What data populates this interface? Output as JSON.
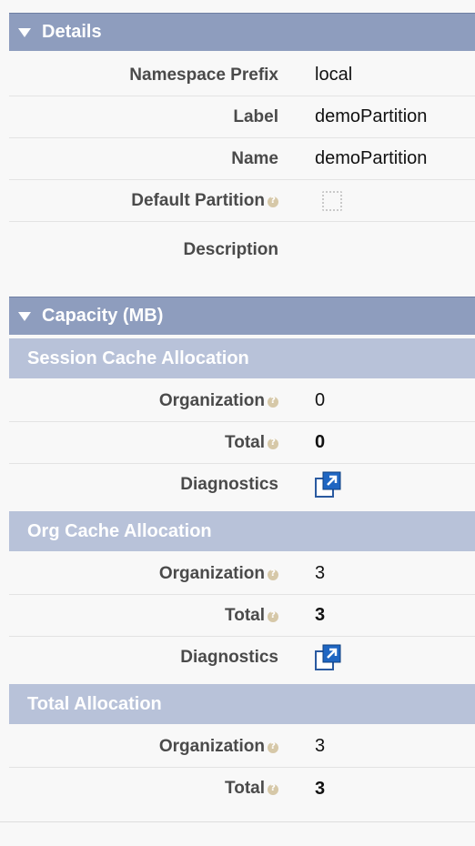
{
  "details": {
    "header": "Details",
    "fields": [
      {
        "label": "Namespace Prefix",
        "value": "local"
      },
      {
        "label": "Label",
        "value": "demoPartition"
      },
      {
        "label": "Name",
        "value": "demoPartition"
      },
      {
        "label": "Default Partition",
        "value": ""
      },
      {
        "label": "Description",
        "value": ""
      }
    ]
  },
  "capacity": {
    "header": "Capacity (MB)",
    "session": {
      "title": "Session Cache Allocation",
      "organization_label": "Organization",
      "organization_value": "0",
      "total_label": "Total",
      "total_value": "0",
      "diagnostics_label": "Diagnostics"
    },
    "org": {
      "title": "Org Cache Allocation",
      "organization_label": "Organization",
      "organization_value": "3",
      "total_label": "Total",
      "total_value": "3",
      "diagnostics_label": "Diagnostics"
    },
    "total": {
      "title": "Total Allocation",
      "organization_label": "Organization",
      "organization_value": "3",
      "total_label": "Total",
      "total_value": "3"
    }
  },
  "icons": {
    "collapse": "triangle-down-icon",
    "help": "help-icon",
    "diagnostics": "external-link-icon",
    "checkbox": "checkbox-unchecked"
  },
  "colors": {
    "section_header": "#8e9dbe",
    "sub_header": "#b8c2d9",
    "help": "#d6c8a8"
  }
}
